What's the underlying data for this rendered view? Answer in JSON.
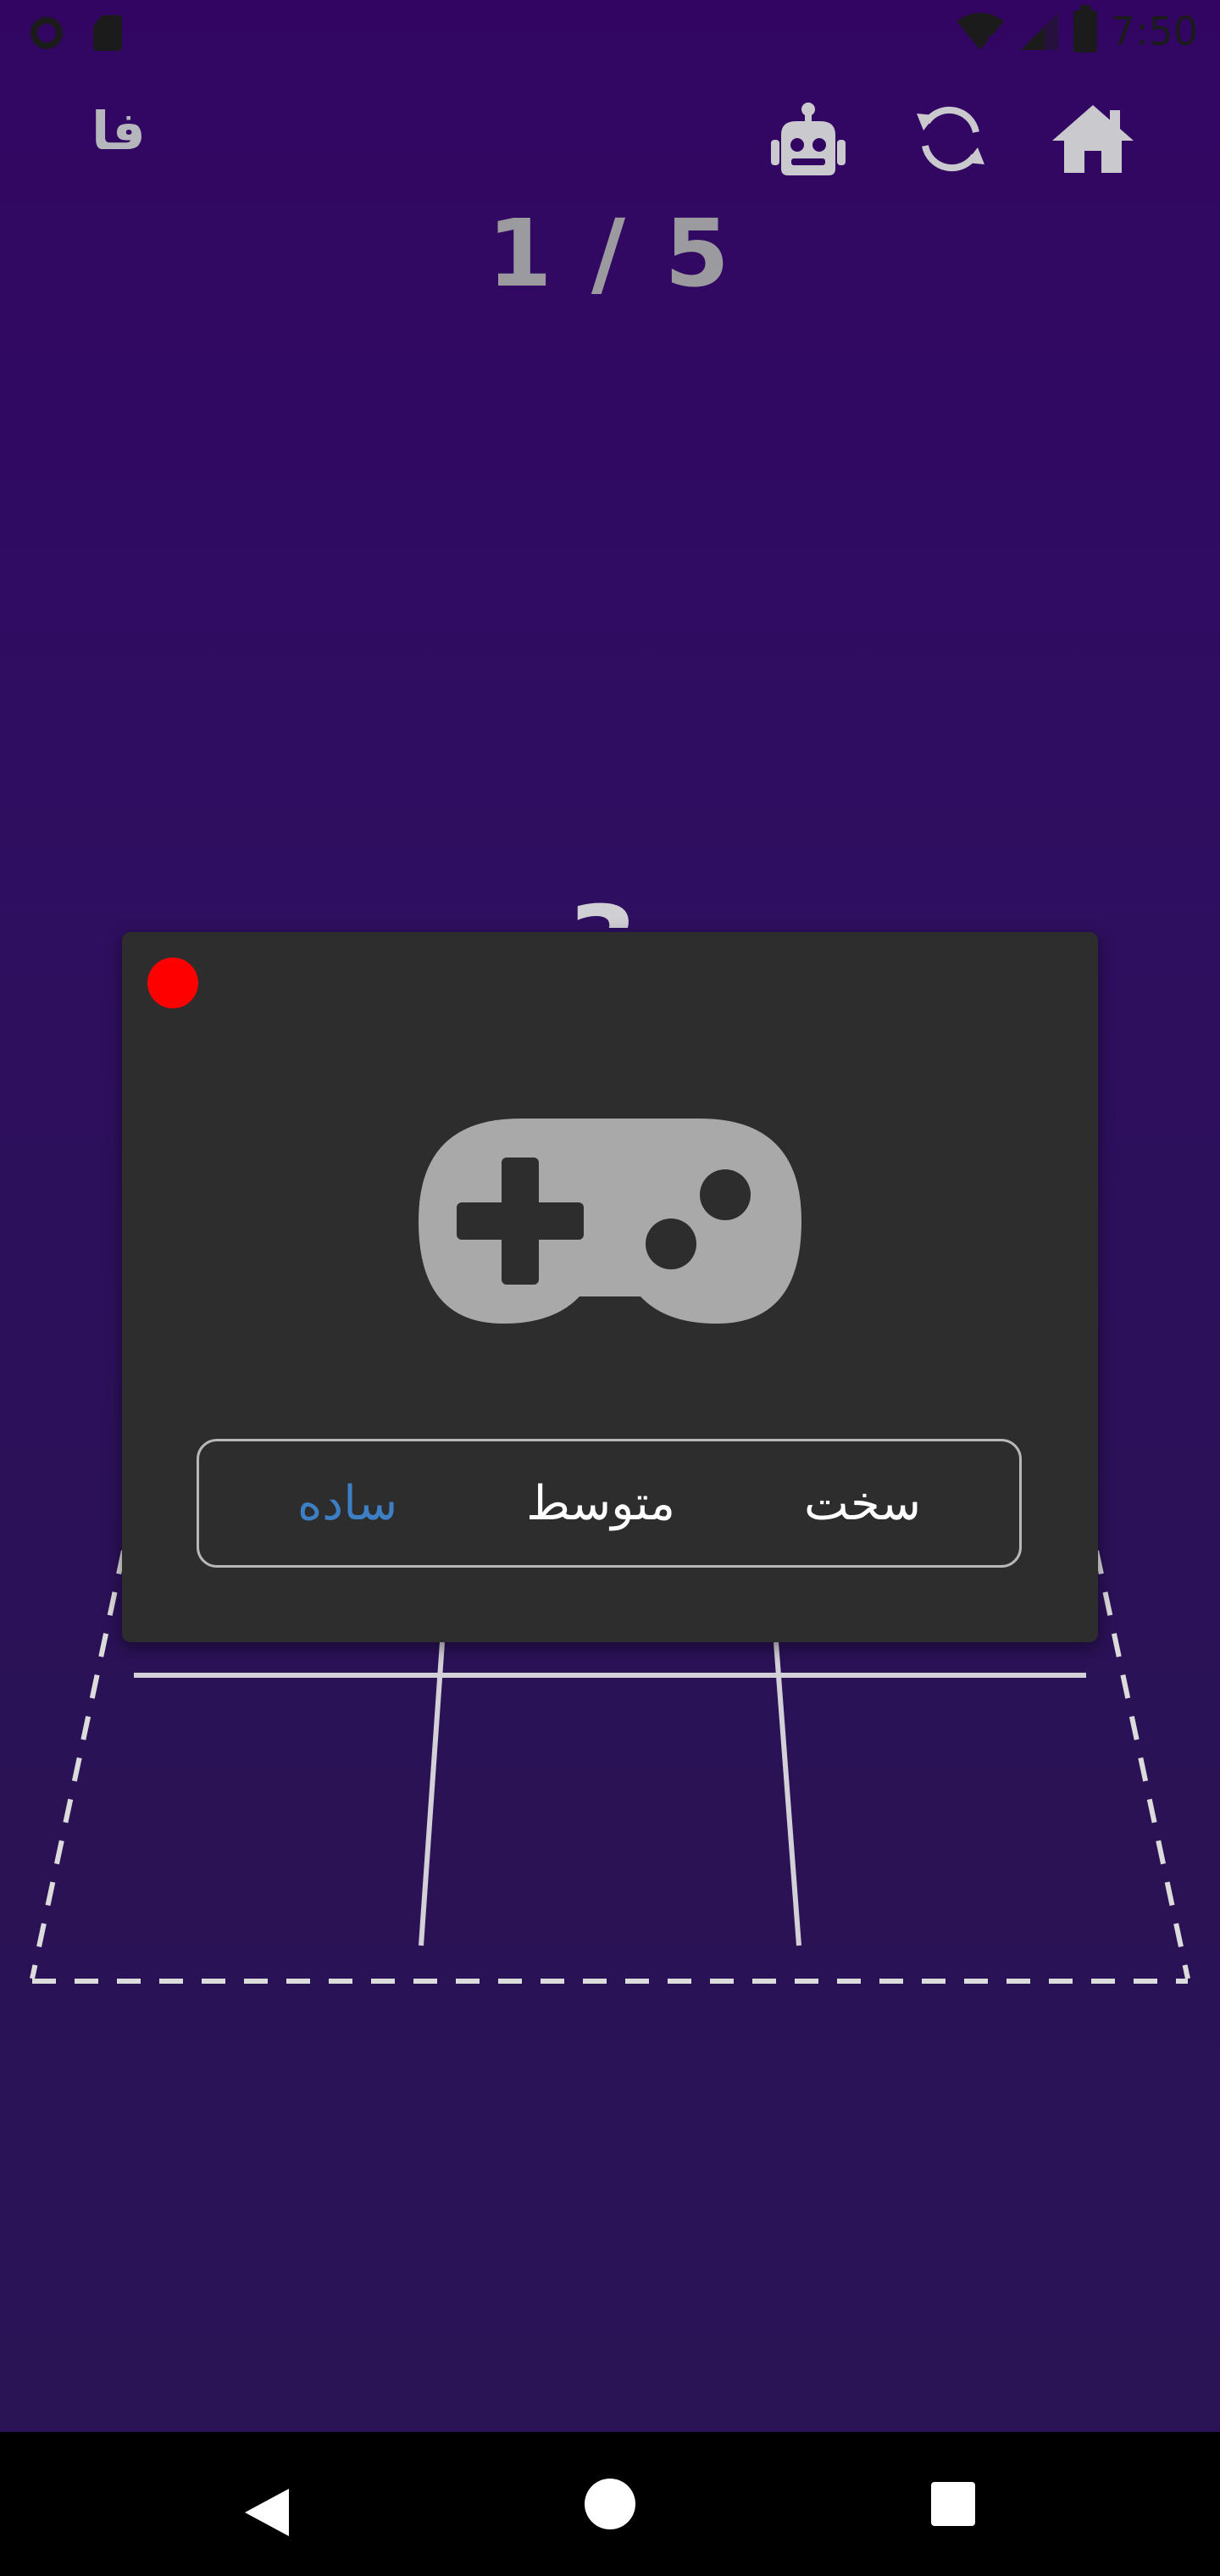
{
  "status_bar": {
    "time": "7:50",
    "icons": [
      "sync-icon",
      "sd-card-icon",
      "wifi-icon",
      "signal-icon",
      "battery-icon"
    ]
  },
  "top_bar": {
    "language_label": "فا",
    "icons": [
      "robot-icon",
      "refresh-icon",
      "home-icon"
    ]
  },
  "progress": {
    "counter_text": "1 / 5"
  },
  "board": {
    "peek_number": "3"
  },
  "dialog": {
    "icon": "gamepad-icon",
    "close_color": "#ff0000",
    "difficulty_options": [
      {
        "label": "ساده",
        "selected": true
      },
      {
        "label": "متوسط",
        "selected": false
      },
      {
        "label": "سخت",
        "selected": false
      }
    ]
  },
  "colors": {
    "background": "#320563",
    "dialog_bg": "#2d2d2d",
    "selected_option": "#3d7fc4",
    "icon_gray": "#a9a9a9"
  },
  "nav_bar": {
    "icons": [
      "back-icon",
      "home-circle-icon",
      "recent-apps-icon"
    ]
  }
}
